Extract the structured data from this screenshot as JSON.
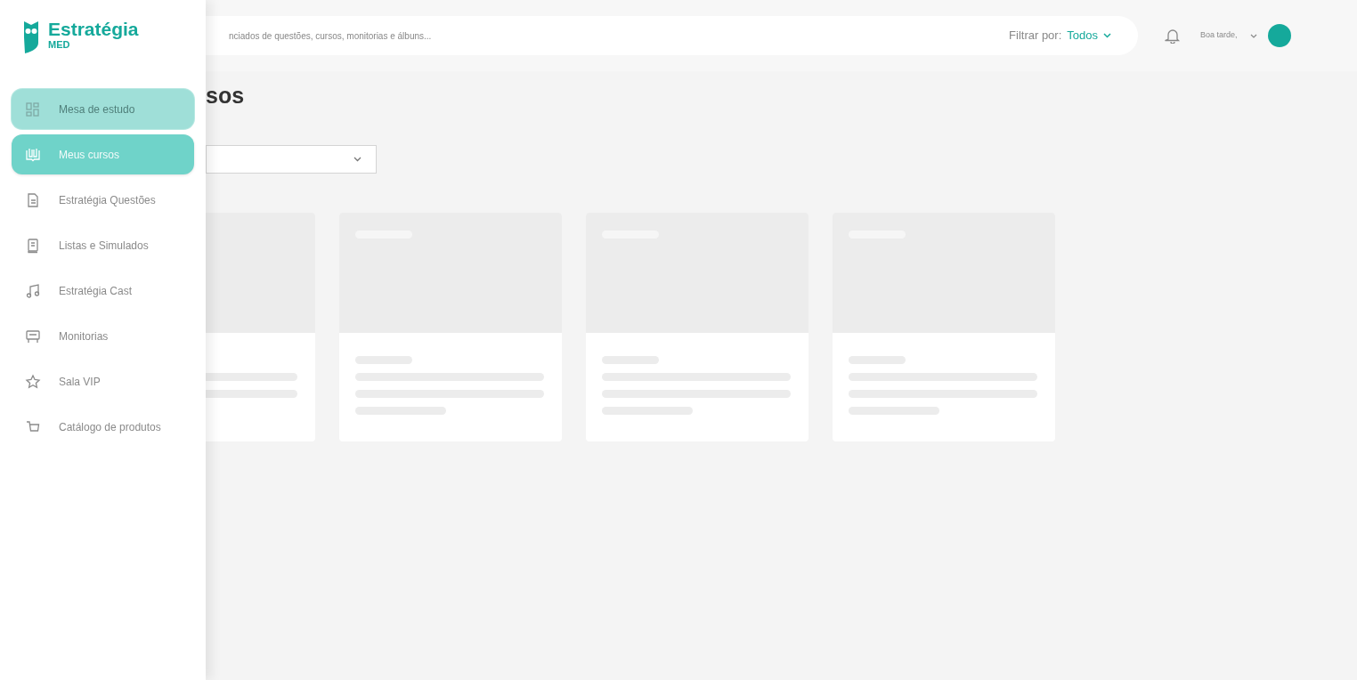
{
  "logo": {
    "name": "Estratégia",
    "sub": "MED"
  },
  "sidebar": {
    "items": [
      {
        "label": "Mesa de estudo",
        "selected": false,
        "hovered": true
      },
      {
        "label": "Meus cursos",
        "selected": true,
        "hovered": false
      },
      {
        "label": "Estratégia Questões",
        "selected": false,
        "hovered": false
      },
      {
        "label": "Listas e Simulados",
        "selected": false,
        "hovered": false
      },
      {
        "label": "Estratégia Cast",
        "selected": false,
        "hovered": false
      },
      {
        "label": "Monitorias",
        "selected": false,
        "hovered": false
      },
      {
        "label": "Sala VIP",
        "selected": false,
        "hovered": false
      },
      {
        "label": "Catálogo de produtos",
        "selected": false,
        "hovered": false
      }
    ]
  },
  "search": {
    "placeholder": "nciados de questões, cursos, monitorias e álbuns..."
  },
  "filter": {
    "label": "Filtrar por:",
    "value": "Todos"
  },
  "greeting": "Boa tarde,",
  "page_title": "sos",
  "course_cards": [
    {
      "kind": "skeleton"
    },
    {
      "kind": "skeleton"
    },
    {
      "kind": "skeleton"
    },
    {
      "kind": "skeleton"
    }
  ]
}
